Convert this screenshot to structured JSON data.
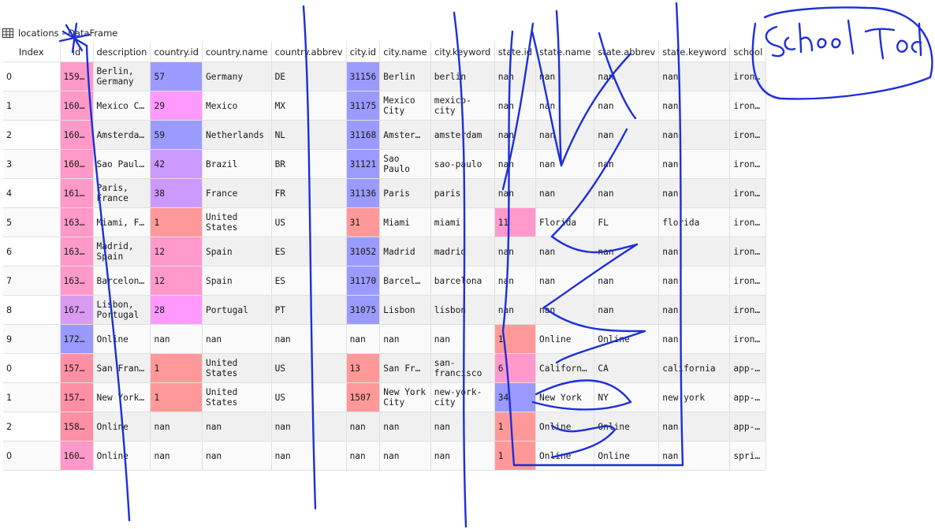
{
  "window": {
    "title": "locations - DataFrame"
  },
  "table": {
    "columns": [
      "Index",
      "id",
      "description",
      "country.id",
      "country.name",
      "country.abbrev",
      "city.id",
      "city.name",
      "city.keyword",
      "state.id",
      "state.name",
      "state.abbrev",
      "state.keyword",
      "school"
    ],
    "rows": [
      [
        "0",
        "159…",
        "Berlin,\nGermany",
        "57",
        "Germany",
        "DE",
        "31156",
        "Berlin",
        "berlin",
        "nan",
        "nan",
        "nan",
        "nan",
        "iron…"
      ],
      [
        "1",
        "160…",
        "Mexico C…",
        "29",
        "Mexico",
        "MX",
        "31175",
        "Mexico\nCity",
        "mexico-\ncity",
        "nan",
        "nan",
        "nan",
        "nan",
        "iron…"
      ],
      [
        "2",
        "160…",
        "Amsterda…",
        "59",
        "Netherlands",
        "NL",
        "31168",
        "Amster…",
        "amsterdam",
        "nan",
        "nan",
        "nan",
        "nan",
        "iron…"
      ],
      [
        "3",
        "160…",
        "Sao Paul…",
        "42",
        "Brazil",
        "BR",
        "31121",
        "Sao\nPaulo",
        "sao-paulo",
        "nan",
        "nan",
        "nan",
        "nan",
        "iron…"
      ],
      [
        "4",
        "161…",
        "Paris,\nFrance",
        "38",
        "France",
        "FR",
        "31136",
        "Paris",
        "paris",
        "nan",
        "nan",
        "nan",
        "nan",
        "iron…"
      ],
      [
        "5",
        "163…",
        "Miami, F…",
        "1",
        "United\nStates",
        "US",
        "31",
        "Miami",
        "miami",
        "11",
        "Florida",
        "FL",
        "florida",
        "iron…"
      ],
      [
        "6",
        "163…",
        "Madrid,\nSpain",
        "12",
        "Spain",
        "ES",
        "31052",
        "Madrid",
        "madrid",
        "nan",
        "nan",
        "nan",
        "nan",
        "iron…"
      ],
      [
        "7",
        "163…",
        "Barcelon…",
        "12",
        "Spain",
        "ES",
        "31170",
        "Barcel…",
        "barcelona",
        "nan",
        "nan",
        "nan",
        "nan",
        "iron…"
      ],
      [
        "8",
        "167…",
        "Lisbon,\nPortugal",
        "28",
        "Portugal",
        "PT",
        "31075",
        "Lisbon",
        "lisbon",
        "nan",
        "nan",
        "nan",
        "nan",
        "iron…"
      ],
      [
        "9",
        "172…",
        "Online",
        "nan",
        "nan",
        "nan",
        "nan",
        "nan",
        "nan",
        "1",
        "Online",
        "Online",
        "nan",
        "iron…"
      ],
      [
        "0",
        "157…",
        "San Fran…",
        "1",
        "United\nStates",
        "US",
        "13",
        "San Fr…",
        "san-\nfrancisco",
        "6",
        "Californ…",
        "CA",
        "california",
        "app-…"
      ],
      [
        "1",
        "157…",
        "New York…",
        "1",
        "United\nStates",
        "US",
        "1507",
        "New York\nCity",
        "new-york-\ncity",
        "34",
        "New York",
        "NY",
        "new-york",
        "app-…"
      ],
      [
        "2",
        "158…",
        "Online",
        "nan",
        "nan",
        "nan",
        "nan",
        "nan",
        "nan",
        "1",
        "Online",
        "Online",
        "nan",
        "app-…"
      ],
      [
        "0",
        "160…",
        "Online",
        "nan",
        "nan",
        "nan",
        "nan",
        "nan",
        "nan",
        "1",
        "Online",
        "Online",
        "nan",
        "spri…"
      ]
    ]
  },
  "colors": {
    "id": [
      "#ff99c8",
      "#ff99c8",
      "#ff99c8",
      "#ff99c8",
      "#ff99c8",
      "#ff99c8",
      "#ff99c8",
      "#ff99c8",
      "#d99bf0",
      "#9999ff",
      "#ff8fa5",
      "#ff8fa5",
      "#ff8fa5",
      "#ff99c8"
    ],
    "country_id": [
      "#9b9bff",
      "#ff99ff",
      "#9b9bff",
      "#cc99ff",
      "#cc99ff",
      "#ff9999",
      "#ff99cc",
      "#ff99cc",
      "#ff99ff",
      null,
      "#ff9999",
      "#ff9999",
      null,
      null
    ],
    "city_id": [
      "#9b9bff",
      "#9b9bff",
      "#9b9bff",
      "#9b9bff",
      "#9b9bff",
      "#ff9999",
      "#9b9bff",
      "#9b9bff",
      "#9b9bff",
      null,
      "#ff9999",
      "#ff9999",
      null,
      null
    ],
    "state_id": [
      null,
      null,
      null,
      null,
      null,
      "#ff99cc",
      null,
      null,
      null,
      "#ff9999",
      "#ff99cc",
      "#9999ff",
      "#ff9999",
      "#ff9999"
    ]
  },
  "annotation": {
    "label": "School Tod",
    "color": "#1d2fd9"
  }
}
